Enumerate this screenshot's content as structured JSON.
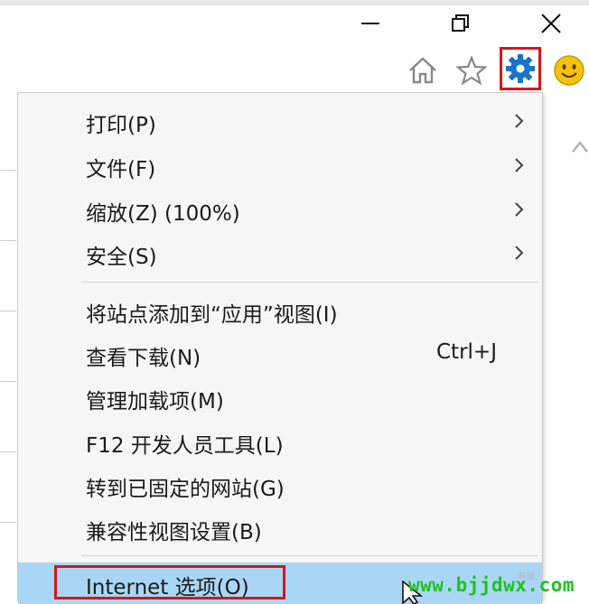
{
  "window_controls": {
    "minimize": "minimize-icon",
    "restore": "restore-icon",
    "close": "close-icon"
  },
  "toolbar": {
    "home": "home-icon",
    "favorites": "star-icon",
    "tools": "gear-icon",
    "feedback": "smiley-icon"
  },
  "colors": {
    "highlight_box": "#d9141b",
    "selected_row": "#a9d6f5",
    "gear": "#1a73c8",
    "smiley": "#f4c20d",
    "watermark": "#22c21f"
  },
  "menu": {
    "items": [
      {
        "label": "打印(P)",
        "submenu": true
      },
      {
        "label": "文件(F)",
        "submenu": true
      },
      {
        "label": "缩放(Z) (100%)",
        "submenu": true
      },
      {
        "label": "安全(S)",
        "submenu": true
      },
      {
        "label": "将站点添加到“应用”视图(I)"
      },
      {
        "label": "查看下载(N)",
        "shortcut": "Ctrl+J"
      },
      {
        "label": "管理加载项(M)"
      },
      {
        "label": "F12 开发人员工具(L)"
      },
      {
        "label": "转到已固定的网站(G)"
      },
      {
        "label": "兼容性视图设置(B)"
      },
      {
        "label": "Internet 选项(O)",
        "selected": true
      }
    ]
  },
  "watermark": {
    "url": "www.bjjdwx.com",
    "small": "电脑"
  }
}
